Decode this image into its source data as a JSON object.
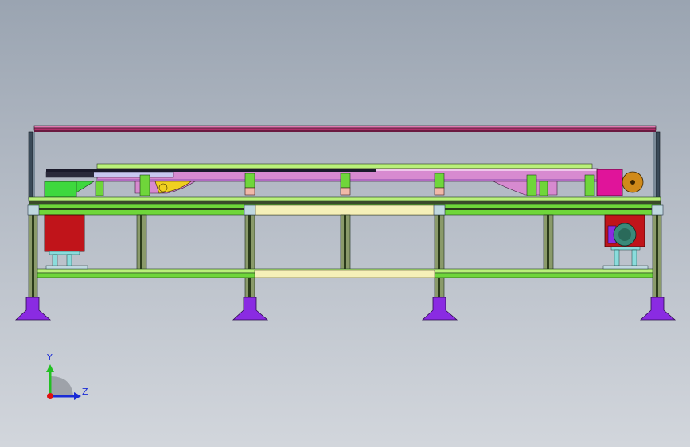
{
  "viewport": {
    "background_top": "#9aa4b1",
    "background_bottom": "#d2d6dc"
  },
  "model": {
    "colors": {
      "frame_green": "#6fd63a",
      "frame_dark": "#2a3a1a",
      "top_rail": "#b0306a",
      "belt_pink": "#d78ad0",
      "belt_light": "#efc6ec",
      "belt_shade": "#b06ac0",
      "foot_purple": "#8a2be2",
      "motor_red": "#c0141a",
      "motor_magenta": "#e0149a",
      "gear_orange": "#d08a1a",
      "motor_teal": "#3a8a7a",
      "mount_cyan": "#8adcdc",
      "crossbar_cream": "#f5f0b8",
      "bracket_pink": "#f0b8a8",
      "yellow_part": "#f0d020"
    }
  },
  "triad": {
    "y_label": "Y",
    "z_label": "Z",
    "y_color": "#22c022",
    "z_color": "#1a2bd6",
    "origin_color": "#e01010"
  }
}
